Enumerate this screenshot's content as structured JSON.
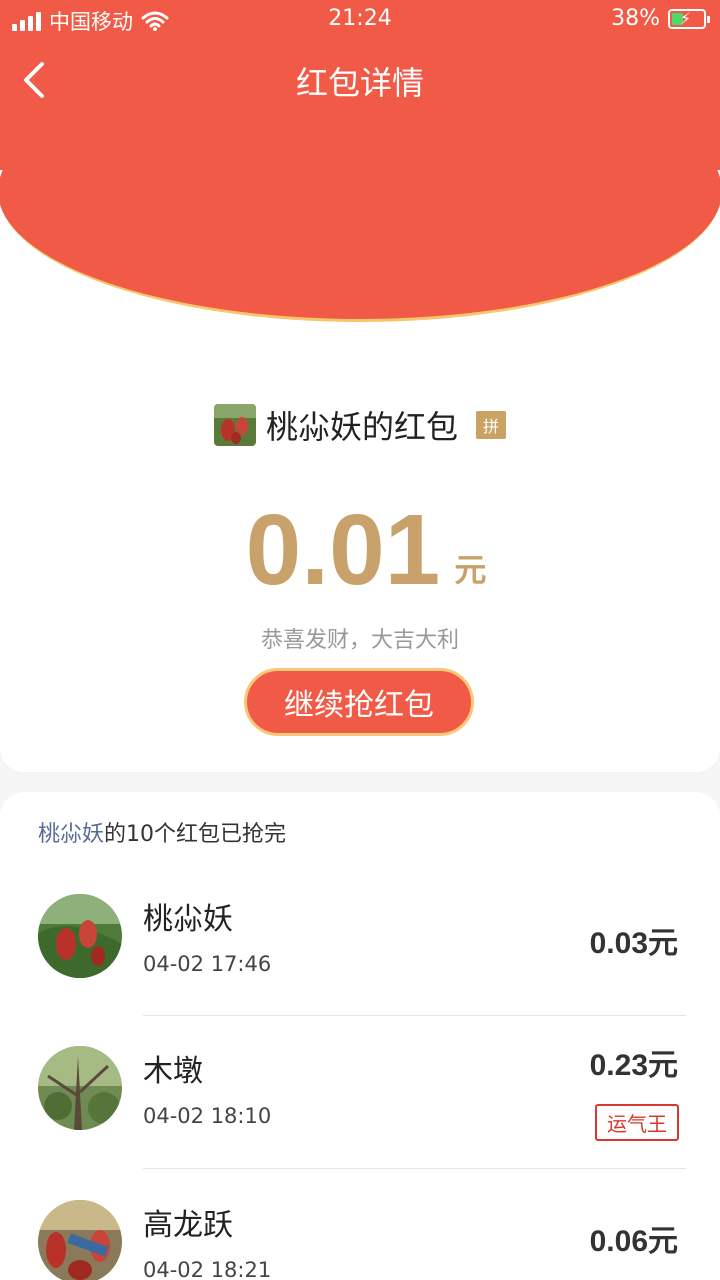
{
  "status_bar": {
    "carrier": "中国移动",
    "time": "21:24",
    "battery_percent": "38%",
    "battery_level": 0.38
  },
  "nav": {
    "title": "红包详情",
    "back_icon": "chevron-left-icon"
  },
  "packet": {
    "sender_name": "桃尛妖的红包",
    "badge": "拼",
    "amount": "0.01",
    "unit": "元",
    "greeting": "恭喜发财，大吉大利",
    "continue_label": "继续抢红包"
  },
  "summary": {
    "owner": "桃尛妖",
    "text": "的10个红包已抢完"
  },
  "records": [
    {
      "name": "桃尛妖",
      "time": "04-02 17:46",
      "amount": "0.03",
      "unit": "元",
      "badge": ""
    },
    {
      "name": "木墩",
      "time": "04-02 18:10",
      "amount": "0.23",
      "unit": "元",
      "badge": "运气王"
    },
    {
      "name": "高龙跃",
      "time": "04-02 18:21",
      "amount": "0.06",
      "unit": "元",
      "badge": ""
    }
  ],
  "colors": {
    "header_red": "#f15a46",
    "gold": "#c8a26a",
    "link_blue": "#576b95",
    "lucky_red": "#d63a2d"
  }
}
